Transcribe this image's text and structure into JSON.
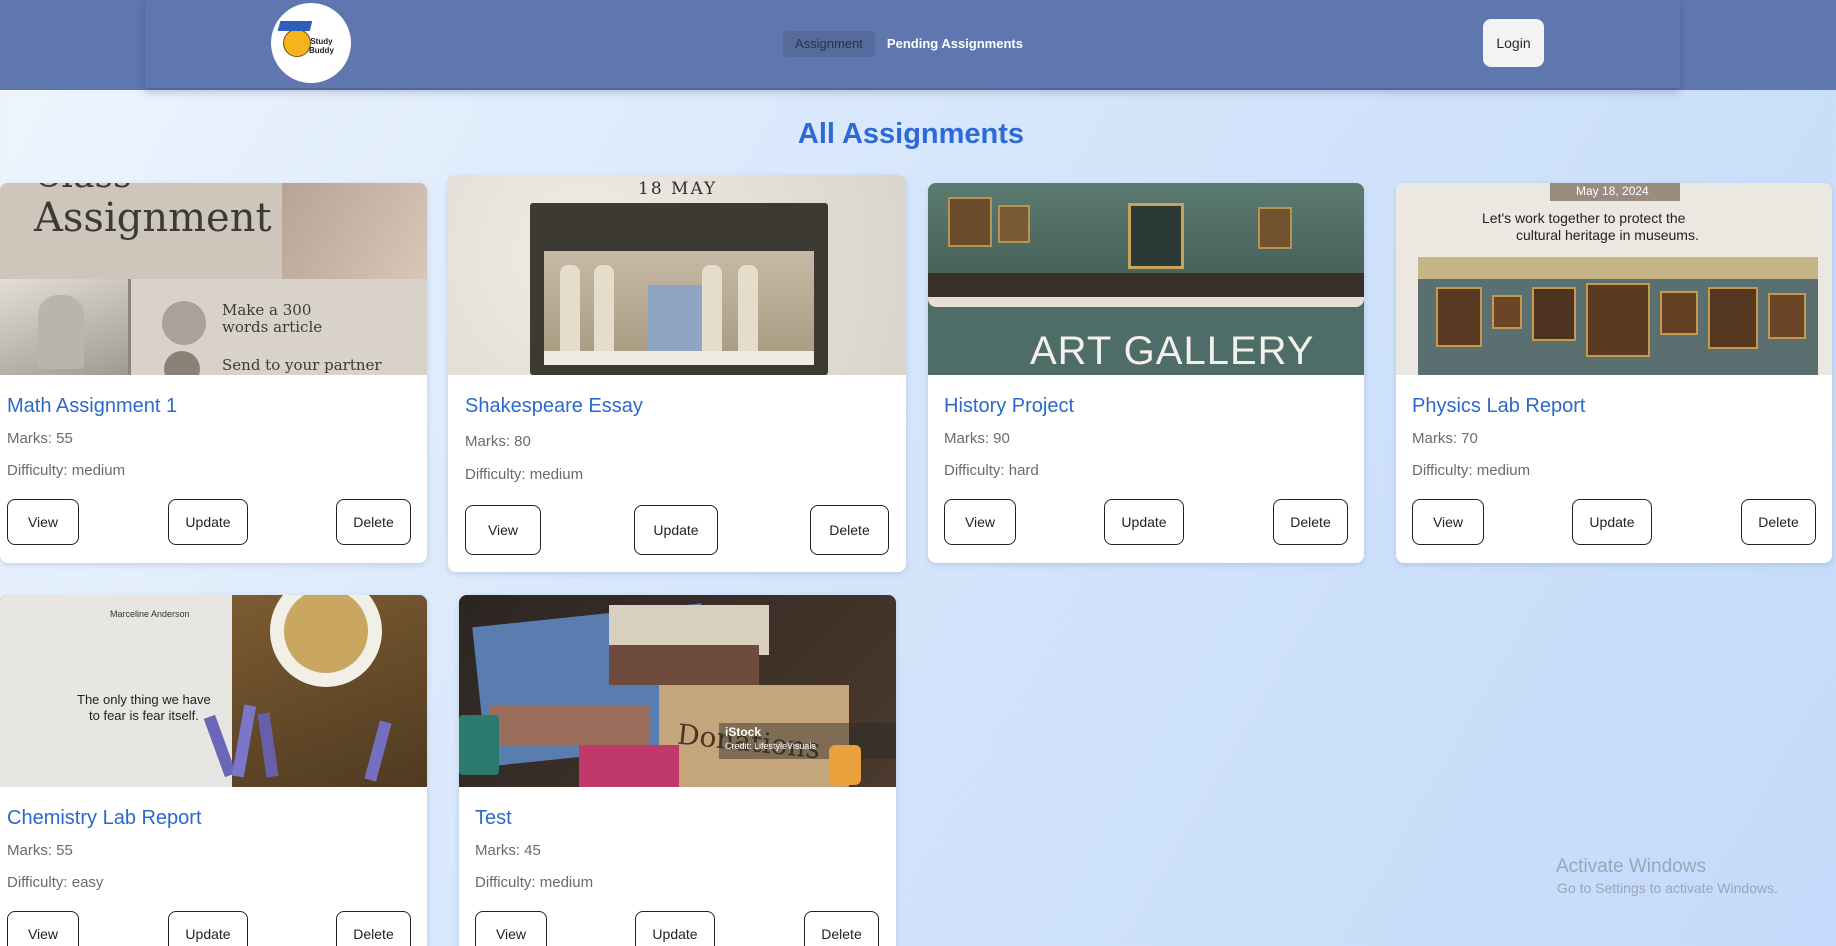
{
  "app": {
    "logo_text_line1": "Study",
    "logo_text_line2": "Buddy"
  },
  "nav": {
    "links": [
      {
        "label": "Assignment",
        "active": true
      },
      {
        "label": "Pending Assignments",
        "active": false
      }
    ],
    "login_label": "Login"
  },
  "page": {
    "title": "All Assignments"
  },
  "labels": {
    "view": "View",
    "update": "Update",
    "delete": "Delete"
  },
  "assignments": [
    {
      "title": "Math Assignment 1",
      "marks": "Marks: 55",
      "difficulty": "Difficulty: medium",
      "image": {
        "heading": "Assignment",
        "heading_partial": "Class",
        "line1": "Make a 300",
        "line2": "words article",
        "line3": "Send to your partner"
      }
    },
    {
      "title": "Shakespeare Essay",
      "marks": "Marks: 80",
      "difficulty": "Difficulty: medium",
      "image": {
        "date": "18 MAY"
      }
    },
    {
      "title": "History Project",
      "marks": "Marks: 90",
      "difficulty": "Difficulty: hard",
      "image": {
        "heading": "ART GALLERY"
      }
    },
    {
      "title": "Physics Lab Report",
      "marks": "Marks: 70",
      "difficulty": "Difficulty: medium",
      "image": {
        "date": "May 18, 2024",
        "line1": "Let's work together to protect the",
        "line2": "cultural heritage in museums."
      }
    },
    {
      "title": "Chemistry Lab Report",
      "marks": "Marks: 55",
      "difficulty": "Difficulty: easy",
      "image": {
        "author": "Marceline Anderson",
        "line1": "The only thing we have",
        "line2": "to fear is fear itself."
      }
    },
    {
      "title": "Test",
      "marks": "Marks: 45",
      "difficulty": "Difficulty: medium",
      "image": {
        "box_text": "Donations",
        "stock": "iStock",
        "credit": "Credit: LifestyleVisuals"
      }
    }
  ],
  "system": {
    "watermark_title": "Activate Windows",
    "watermark_sub": "Go to Settings to activate Windows."
  },
  "colors": {
    "navbar": "#5f76ae",
    "title": "#2d6ad8",
    "card_title": "#2d68cc"
  }
}
